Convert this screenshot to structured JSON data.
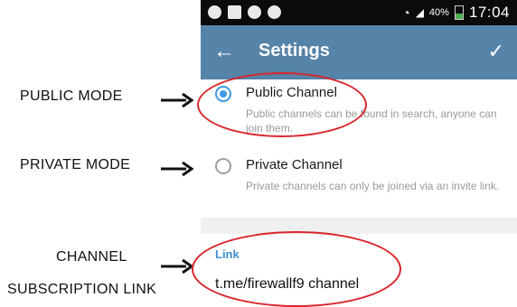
{
  "annotations": {
    "public_mode": "PUBLIC MODE",
    "private_mode": "PRIVATE MODE",
    "channel_line1": "CHANNEL",
    "channel_line2": "SUBSCRIPTION LINK"
  },
  "statusbar": {
    "battery": "40%",
    "time": "17:04"
  },
  "appbar": {
    "back_icon": "arrow-left",
    "title": "Settings",
    "confirm_icon": "check"
  },
  "options": [
    {
      "title": "Public Channel",
      "description": "Public channels can be found in search, anyone can join them.",
      "selected": true
    },
    {
      "title": "Private Channel",
      "description": "Private channels can only be joined via an invite link.",
      "selected": false
    }
  ],
  "link": {
    "label": "Link",
    "value": "t.me/firewallf9 channel"
  },
  "colors": {
    "appbar": "#5683a8",
    "accent": "#3f9ae3",
    "highlight": "#d9262b"
  }
}
